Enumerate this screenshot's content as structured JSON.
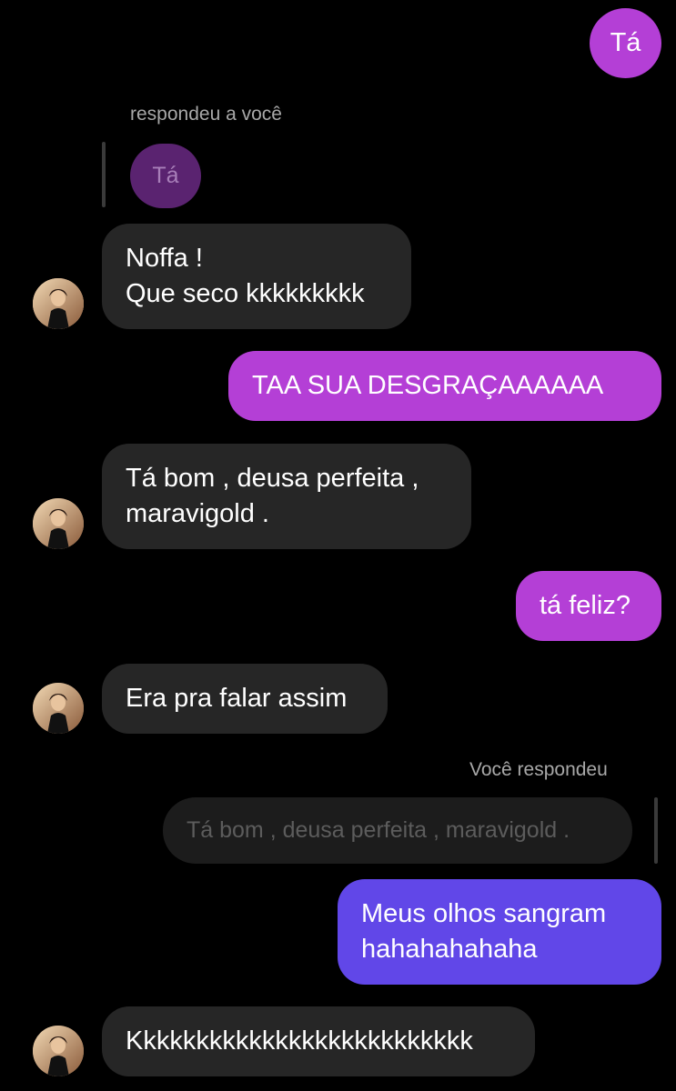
{
  "colors": {
    "background": "#000000",
    "received_bubble": "#262626",
    "sent_pink": "#b43fd6",
    "sent_blue": "#6147e8",
    "quoted_pink": "#5a2370",
    "quoted_dark": "#1c1c1c",
    "meta_text": "#a8a8a8"
  },
  "avatar": {
    "icon": "contact-avatar-photo"
  },
  "messages": [
    {
      "id": "m1",
      "direction": "sent",
      "text": "Tá"
    },
    {
      "id": "m2",
      "reply_label": "respondeu a você",
      "quoted_text": "Tá"
    },
    {
      "id": "m3",
      "direction": "received",
      "text": "Noffa !\nQue seco kkkkkkkkk"
    },
    {
      "id": "m4",
      "direction": "sent",
      "text": "TAA SUA DESGRAÇAAAAAA"
    },
    {
      "id": "m5",
      "direction": "received",
      "text": "Tá bom , deusa perfeita ,\nmaravigold ."
    },
    {
      "id": "m6",
      "direction": "sent",
      "text": "tá feliz?"
    },
    {
      "id": "m7",
      "direction": "received",
      "text": "Era pra falar assim"
    },
    {
      "id": "m8",
      "reply_label": "Você respondeu",
      "quoted_text": "Tá bom , deusa perfeita , maravigold ."
    },
    {
      "id": "m9",
      "direction": "sent",
      "text": "Meus olhos sangram\nhahahahahaha"
    },
    {
      "id": "m10",
      "direction": "received",
      "text": "Kkkkkkkkkkkkkkkkkkkkkkkkkk"
    }
  ]
}
